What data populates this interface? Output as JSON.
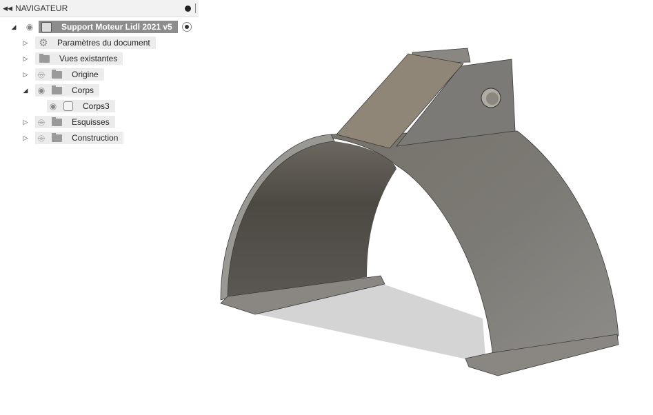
{
  "navigator": {
    "title": "NAVIGATEUR",
    "root": {
      "label": "Support Moteur Lidl 2021 v5"
    },
    "items": [
      {
        "label": "Paramètres du document",
        "icon": "gear-icon"
      },
      {
        "label": "Vues existantes",
        "icon": "folder-icon"
      },
      {
        "label": "Origine",
        "icon": "folder-icon",
        "visible": false
      },
      {
        "label": "Corps",
        "icon": "folder-icon",
        "visible": true,
        "expanded": true
      },
      {
        "label": "Corps3",
        "icon": "body-icon",
        "visible": true
      },
      {
        "label": "Esquisses",
        "icon": "folder-icon",
        "visible": false
      },
      {
        "label": "Construction",
        "icon": "folder-icon",
        "visible": false
      }
    ]
  },
  "colors": {
    "selected_root": "#8d8d8d",
    "model_surface": "#7f7c77",
    "bracket_top": "#8f8677"
  }
}
